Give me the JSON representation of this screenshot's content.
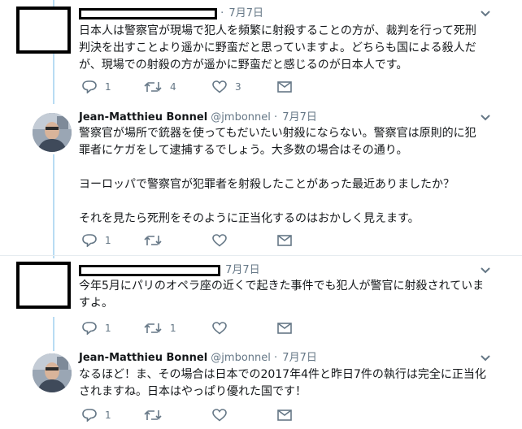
{
  "tweets": [
    {
      "author_redacted": true,
      "date": "7月7日",
      "lines": [
        "日本人は警察官が現場で犯人を頻繁に射殺することの方が、裁判を行って死刑",
        "判決を出すことより遥かに野蛮だと思っていますよ。どちらも国による殺人だ",
        "が、現場での射殺の方が遥かに野蛮だと感じるのが日本人です。"
      ],
      "replies": "1",
      "retweets": "4",
      "likes": "3"
    },
    {
      "author_redacted": false,
      "name": "Jean-Matthieu Bonnel",
      "handle": "@jmbonnel",
      "date": "7月7日",
      "lines": [
        "警察官が場所で銃器を使ってもだいたい射殺にならない。警察官は原則的に犯",
        "罪者にケガをして逮捕するでしょう。大多数の場合はその通り。",
        "",
        "ヨーロッパで警察官が犯罪者を射殺したことがあった最近ありましたか？",
        "",
        "それを見たら死刑をそのように正当化するのはおかしく見えます。"
      ],
      "replies": "1",
      "retweets": "",
      "likes": ""
    },
    {
      "author_redacted": true,
      "date": "7月7日",
      "lines": [
        "今年5月にパリのオペラ座の近くで起きた事件でも犯人が警官に射殺されていま",
        "すよ。"
      ],
      "replies": "1",
      "retweets": "1",
      "likes": ""
    },
    {
      "author_redacted": false,
      "name": "Jean-Matthieu Bonnel",
      "handle": "@jmbonnel",
      "date": "7月7日",
      "lines": [
        "なるほど！ま、その場合は日本での2017年4件と昨日7件の執行は完全に正当化",
        "されますね。日本はやっぱり優れた国です！"
      ],
      "replies": "1",
      "retweets": "",
      "likes": ""
    }
  ],
  "ui": {
    "separator": "·",
    "icons": [
      "reply-icon",
      "retweet-icon",
      "like-icon",
      "message-icon",
      "chevron-down-icon"
    ],
    "colors": {
      "thread_line": "#b8dcf3",
      "meta": "#657786",
      "text": "#14171a",
      "divider": "#e6ecf0"
    }
  }
}
